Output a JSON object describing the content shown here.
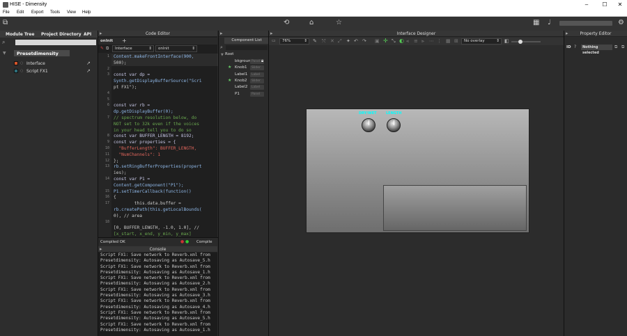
{
  "window": {
    "title": "HISE - Dimensity",
    "min": "–",
    "max": "☐",
    "close": "✕"
  },
  "menu": [
    "File",
    "Edit",
    "Export",
    "Tools",
    "View",
    "Help"
  ],
  "left_panel": {
    "tabs": [
      "Module Tree",
      "Project Directory",
      "API"
    ],
    "root_module": "Presetdimensity",
    "items": [
      {
        "label": "Interface",
        "color": "#d4552b"
      },
      {
        "label": "Script FX1",
        "color": "#2e6e7a"
      }
    ]
  },
  "code_editor": {
    "title": "Code Editor",
    "tab": "onInit",
    "dropdown1": "Interface",
    "dropdown2": "onInit",
    "lines": [
      {
        "n": "1",
        "text": "Content.makeFrontInterface(900,"
      },
      {
        "n": "",
        "text": "500);"
      },
      {
        "n": "2",
        "text": ""
      },
      {
        "n": "3",
        "text": "const var dp ="
      },
      {
        "n": "",
        "text": "Synth.getDisplayBufferSource(\"Scri"
      },
      {
        "n": "",
        "text": "pt FX1\");"
      },
      {
        "n": "4",
        "text": ""
      },
      {
        "n": "5",
        "text": ""
      },
      {
        "n": "6",
        "text": "const var rb ="
      },
      {
        "n": "",
        "text": "dp.getDisplayBuffer(0);"
      },
      {
        "n": "7",
        "text": "// spectrum resolution below, do"
      },
      {
        "n": "",
        "text": "NOT set to 32k even if the voices"
      },
      {
        "n": "",
        "text": "in your head tell you to do so"
      },
      {
        "n": "8",
        "text": "const var BUFFER_LENGTH = 8192;"
      },
      {
        "n": "9",
        "text": "const var properties = {"
      },
      {
        "n": "10",
        "text": "  \"BufferLength\": BUFFER_LENGTH,"
      },
      {
        "n": "11",
        "text": "  \"NumChannels\": 1"
      },
      {
        "n": "12",
        "text": "};"
      },
      {
        "n": "13",
        "text": "rb.setRingBufferProperties(propert"
      },
      {
        "n": "",
        "text": "ies);"
      },
      {
        "n": "14",
        "text": "const var P1 ="
      },
      {
        "n": "",
        "text": "Content.getComponent(\"P1\");"
      },
      {
        "n": "15",
        "text": "P1.setTimerCallback(function()"
      },
      {
        "n": "16",
        "text": "{"
      },
      {
        "n": "17",
        "text": "        this.data.buffer ="
      },
      {
        "n": "",
        "text": "rb.createPath(this.getLocalBounds("
      },
      {
        "n": "",
        "text": "0), // area"
      },
      {
        "n": "18",
        "text": ""
      },
      {
        "n": "",
        "text": "[0, BUFFER_LENGTH, -1.0, 1.0], //"
      },
      {
        "n": "",
        "text": "[x_start, x_end, y_min, y_max]"
      }
    ],
    "status": "Compiled OK",
    "compile_label": "Compile"
  },
  "console": {
    "title": "Console",
    "lines": [
      "Script FX1: Save network to Reverb.xml from",
      "Presetdimensity: Autosaving as Autosave_5.h",
      "Script FX1: Save network to Reverb.xml from",
      "Presetdimensity: Autosaving as Autosave_1.h",
      "Script FX1: Save network to Reverb.xml from",
      "Presetdimensity: Autosaving as Autosave_2.h",
      "Script FX1: Save network to Reverb.xml from",
      "Presetdimensity: Autosaving as Autosave_3.h",
      "Script FX1: Save network to Reverb.xml from",
      "Presetdimensity: Autosaving as Autosave_4.h",
      "Script FX1: Save network to Reverb.xml from",
      "Presetdimensity: Autosaving as Autosave_5.h",
      "Script FX1: Save network to Reverb.xml from",
      "Presetdimensity: Autosaving as Autosave_1.h"
    ]
  },
  "component_list": {
    "title": "Component List",
    "root": "Root",
    "items": [
      {
        "name": "bkground",
        "pill": "Panel",
        "star": false,
        "lock": true
      },
      {
        "name": "Knob1",
        "pill": "Slider",
        "star": true,
        "lock": false
      },
      {
        "name": "Label1",
        "pill": "Label",
        "star": false,
        "lock": false
      },
      {
        "name": "Knob2",
        "pill": "Slider",
        "star": true,
        "lock": false
      },
      {
        "name": "Label2",
        "pill": "Label",
        "star": false,
        "lock": false
      },
      {
        "name": "P1",
        "pill": "Panel",
        "star": false,
        "lock": false
      }
    ]
  },
  "interface_designer": {
    "title": "Interface Designer",
    "zoom": "76%",
    "overlay": "No overlay",
    "slider_level": 0.3,
    "knob_labels": [
      "DRY/WET",
      "LENGTH"
    ]
  },
  "property_editor": {
    "title": "Property Editor",
    "id_label": "ID",
    "selection": "Nothing selected"
  }
}
